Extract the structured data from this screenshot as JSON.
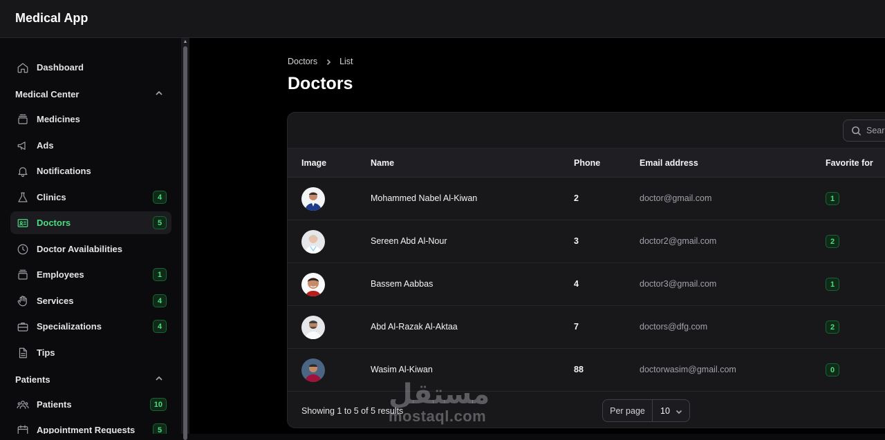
{
  "app": {
    "title": "Medical App"
  },
  "sidebar": {
    "dashboard": {
      "label": "Dashboard",
      "icon": "home-icon"
    },
    "groups": [
      {
        "label": "Medical Center"
      },
      {
        "label": "Patients"
      }
    ],
    "items": [
      {
        "label": "Medicines",
        "icon": "archive-icon",
        "badge": ""
      },
      {
        "label": "Ads",
        "icon": "megaphone-icon",
        "badge": ""
      },
      {
        "label": "Notifications",
        "icon": "bell-icon",
        "badge": ""
      },
      {
        "label": "Clinics",
        "icon": "flask-icon",
        "badge": "4"
      },
      {
        "label": "Doctors",
        "icon": "id-card-icon",
        "badge": "5",
        "active": true
      },
      {
        "label": "Doctor Availabilities",
        "icon": "clock-icon",
        "badge": ""
      },
      {
        "label": "Employees",
        "icon": "archive-icon",
        "badge": "1"
      },
      {
        "label": "Services",
        "icon": "hand-icon",
        "badge": "4"
      },
      {
        "label": "Specializations",
        "icon": "briefcase-icon",
        "badge": "4"
      },
      {
        "label": "Tips",
        "icon": "document-icon",
        "badge": ""
      },
      {
        "label": "Patients",
        "icon": "users-icon",
        "badge": "10"
      },
      {
        "label": "Appointment Requests",
        "icon": "calendar-icon",
        "badge": "5"
      }
    ]
  },
  "breadcrumb": {
    "parent": "Doctors",
    "current": "List"
  },
  "page": {
    "title": "Doctors"
  },
  "search": {
    "placeholder": "Search"
  },
  "table": {
    "columns": [
      "Image",
      "Name",
      "Phone",
      "Email address",
      "Favorite for"
    ],
    "rows": [
      {
        "name": "Mohammed Nabel Al-Kiwan",
        "phone": "2",
        "email": "doctor@gmail.com",
        "favorite": "1"
      },
      {
        "name": "Sereen Abd Al-Nour",
        "phone": "3",
        "email": "doctor2@gmail.com",
        "favorite": "2"
      },
      {
        "name": "Bassem Aabbas",
        "phone": "4",
        "email": "doctor3@gmail.com",
        "favorite": "1"
      },
      {
        "name": "Abd Al-Razak Al-Aktaa",
        "phone": "7",
        "email": "doctors@dfg.com",
        "favorite": "2"
      },
      {
        "name": "Wasim Al-Kiwan",
        "phone": "88",
        "email": "doctorwasim@gmail.com",
        "favorite": "0"
      }
    ]
  },
  "footer": {
    "showing": "Showing 1 to 5 of 5 results",
    "per_page_label": "Per page",
    "per_page_value": "10"
  },
  "watermark": {
    "arabic": "مستقل",
    "latin": "mostaql.com"
  },
  "colors": {
    "accent": "#4ade80",
    "background": "#000000",
    "panel": "#18181b"
  }
}
